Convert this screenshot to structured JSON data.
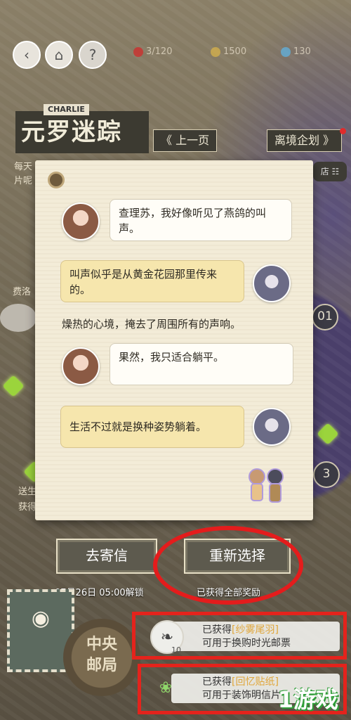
{
  "top_resources": {
    "apple": "3/120",
    "coins": "1500",
    "diamonds": "130"
  },
  "header": {
    "title_badge": "CHARLIE",
    "title": "元罗迷踪",
    "prev_page": "《 上一页",
    "event_plan": "离境企划 》"
  },
  "side": {
    "left_text_1": "每天",
    "left_text_2": "片呢",
    "left_text_3": "费洛",
    "left_text_4": "送生",
    "left_text_5": "获得",
    "store_label": "店",
    "num_01": "01",
    "num_3": "3"
  },
  "dialogue": [
    {
      "speaker": "girl",
      "text": "查理苏，我好像听见了燕鸽的叫声。"
    },
    {
      "speaker": "boy",
      "text": "叫声似乎是从黄金花园那里传来的。"
    },
    {
      "speaker": "narration",
      "text": "燥热的心境，掩去了周围所有的声响。"
    },
    {
      "speaker": "girl",
      "text": "果然，我只适合躺平。"
    },
    {
      "speaker": "boy",
      "text": "生活不过就是换种姿势躺着。"
    }
  ],
  "actions": {
    "send_letter": "去寄信",
    "reselect": "重新选择",
    "unlock_time": "07月26日 05:00解锁",
    "all_rewards": "已获得全部奖励"
  },
  "rewards": [
    {
      "prefix": "已获得",
      "item": "[纱雾尾羽]",
      "desc": "可用于换购时光邮票",
      "count": "10"
    },
    {
      "prefix": "已获得",
      "item": "[回忆贴纸]",
      "desc": "可用于装饰明信片"
    }
  ],
  "seal": {
    "line1": "中央",
    "line2": "邮局"
  },
  "watermark": "1游戏",
  "colors": {
    "highlight": "#e0a63a",
    "annotation_red": "#e41c1c"
  }
}
